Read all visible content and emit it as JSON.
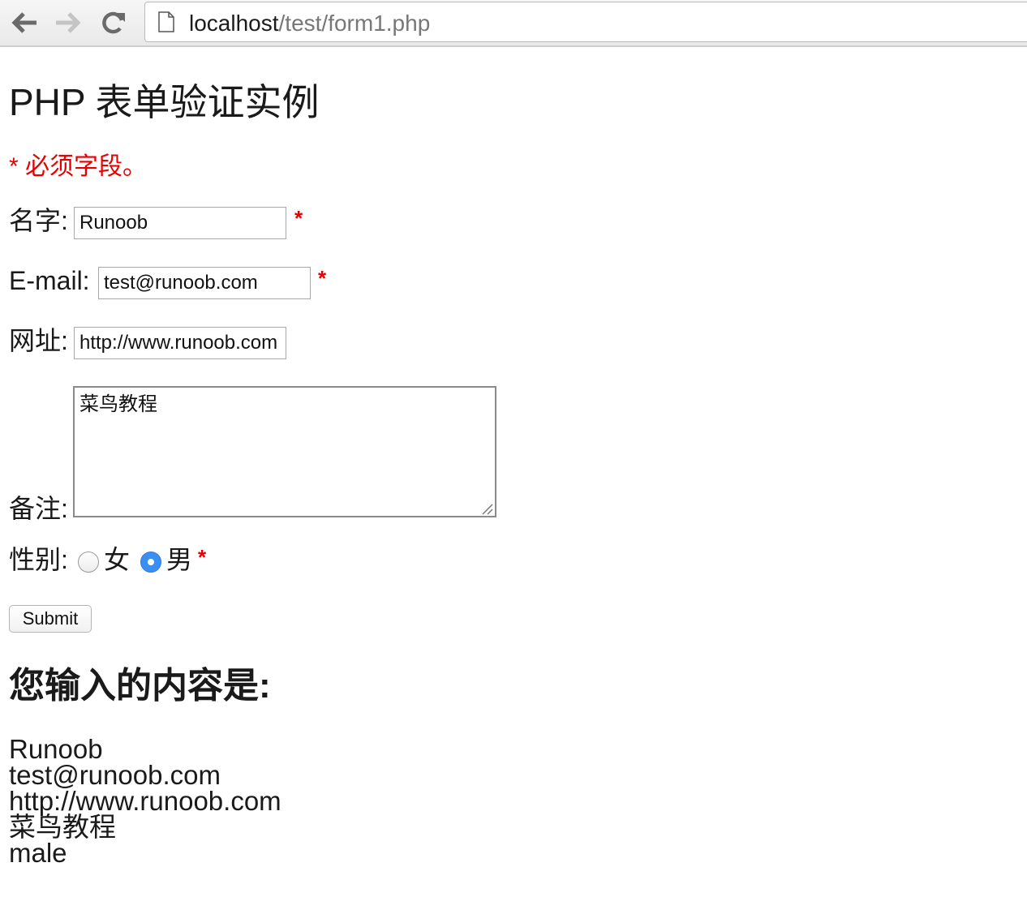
{
  "browser": {
    "url_host": "localhost",
    "url_path": "/test/form1.php"
  },
  "page": {
    "title": "PHP 表单验证实例",
    "required_note": "* 必须字段。"
  },
  "form": {
    "name": {
      "label": "名字:",
      "value": "Runoob",
      "required_mark": "*"
    },
    "email": {
      "label": "E-mail:",
      "value": "test@runoob.com",
      "required_mark": "*"
    },
    "website": {
      "label": "网址:",
      "value": "http://www.runoob.com"
    },
    "comment": {
      "label": "备注:",
      "value": "菜鸟教程"
    },
    "gender": {
      "label": "性别:",
      "options": [
        {
          "label": "女",
          "selected": false
        },
        {
          "label": "男",
          "selected": true
        }
      ],
      "required_mark": "*"
    },
    "submit_label": "Submit"
  },
  "output": {
    "title": "您输入的内容是:",
    "lines": [
      "Runoob",
      "test@runoob.com",
      "http://www.runoob.com",
      "菜鸟教程",
      "male"
    ]
  },
  "colors": {
    "required_red": "#e60000",
    "radio_selected": "#3b8ff0"
  }
}
